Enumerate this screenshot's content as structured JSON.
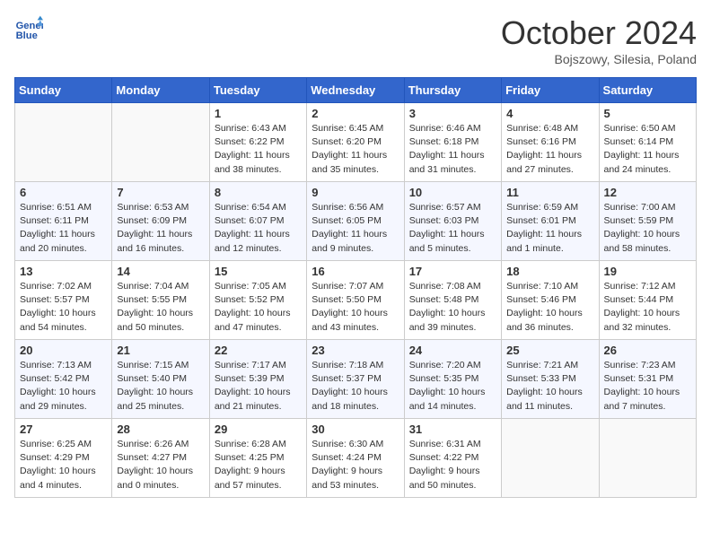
{
  "header": {
    "logo_line1": "General",
    "logo_line2": "Blue",
    "month": "October 2024",
    "location": "Bojszowy, Silesia, Poland"
  },
  "weekdays": [
    "Sunday",
    "Monday",
    "Tuesday",
    "Wednesday",
    "Thursday",
    "Friday",
    "Saturday"
  ],
  "weeks": [
    [
      {
        "day": "",
        "content": ""
      },
      {
        "day": "",
        "content": ""
      },
      {
        "day": "1",
        "content": "Sunrise: 6:43 AM\nSunset: 6:22 PM\nDaylight: 11 hours and 38 minutes."
      },
      {
        "day": "2",
        "content": "Sunrise: 6:45 AM\nSunset: 6:20 PM\nDaylight: 11 hours and 35 minutes."
      },
      {
        "day": "3",
        "content": "Sunrise: 6:46 AM\nSunset: 6:18 PM\nDaylight: 11 hours and 31 minutes."
      },
      {
        "day": "4",
        "content": "Sunrise: 6:48 AM\nSunset: 6:16 PM\nDaylight: 11 hours and 27 minutes."
      },
      {
        "day": "5",
        "content": "Sunrise: 6:50 AM\nSunset: 6:14 PM\nDaylight: 11 hours and 24 minutes."
      }
    ],
    [
      {
        "day": "6",
        "content": "Sunrise: 6:51 AM\nSunset: 6:11 PM\nDaylight: 11 hours and 20 minutes."
      },
      {
        "day": "7",
        "content": "Sunrise: 6:53 AM\nSunset: 6:09 PM\nDaylight: 11 hours and 16 minutes."
      },
      {
        "day": "8",
        "content": "Sunrise: 6:54 AM\nSunset: 6:07 PM\nDaylight: 11 hours and 12 minutes."
      },
      {
        "day": "9",
        "content": "Sunrise: 6:56 AM\nSunset: 6:05 PM\nDaylight: 11 hours and 9 minutes."
      },
      {
        "day": "10",
        "content": "Sunrise: 6:57 AM\nSunset: 6:03 PM\nDaylight: 11 hours and 5 minutes."
      },
      {
        "day": "11",
        "content": "Sunrise: 6:59 AM\nSunset: 6:01 PM\nDaylight: 11 hours and 1 minute."
      },
      {
        "day": "12",
        "content": "Sunrise: 7:00 AM\nSunset: 5:59 PM\nDaylight: 10 hours and 58 minutes."
      }
    ],
    [
      {
        "day": "13",
        "content": "Sunrise: 7:02 AM\nSunset: 5:57 PM\nDaylight: 10 hours and 54 minutes."
      },
      {
        "day": "14",
        "content": "Sunrise: 7:04 AM\nSunset: 5:55 PM\nDaylight: 10 hours and 50 minutes."
      },
      {
        "day": "15",
        "content": "Sunrise: 7:05 AM\nSunset: 5:52 PM\nDaylight: 10 hours and 47 minutes."
      },
      {
        "day": "16",
        "content": "Sunrise: 7:07 AM\nSunset: 5:50 PM\nDaylight: 10 hours and 43 minutes."
      },
      {
        "day": "17",
        "content": "Sunrise: 7:08 AM\nSunset: 5:48 PM\nDaylight: 10 hours and 39 minutes."
      },
      {
        "day": "18",
        "content": "Sunrise: 7:10 AM\nSunset: 5:46 PM\nDaylight: 10 hours and 36 minutes."
      },
      {
        "day": "19",
        "content": "Sunrise: 7:12 AM\nSunset: 5:44 PM\nDaylight: 10 hours and 32 minutes."
      }
    ],
    [
      {
        "day": "20",
        "content": "Sunrise: 7:13 AM\nSunset: 5:42 PM\nDaylight: 10 hours and 29 minutes."
      },
      {
        "day": "21",
        "content": "Sunrise: 7:15 AM\nSunset: 5:40 PM\nDaylight: 10 hours and 25 minutes."
      },
      {
        "day": "22",
        "content": "Sunrise: 7:17 AM\nSunset: 5:39 PM\nDaylight: 10 hours and 21 minutes."
      },
      {
        "day": "23",
        "content": "Sunrise: 7:18 AM\nSunset: 5:37 PM\nDaylight: 10 hours and 18 minutes."
      },
      {
        "day": "24",
        "content": "Sunrise: 7:20 AM\nSunset: 5:35 PM\nDaylight: 10 hours and 14 minutes."
      },
      {
        "day": "25",
        "content": "Sunrise: 7:21 AM\nSunset: 5:33 PM\nDaylight: 10 hours and 11 minutes."
      },
      {
        "day": "26",
        "content": "Sunrise: 7:23 AM\nSunset: 5:31 PM\nDaylight: 10 hours and 7 minutes."
      }
    ],
    [
      {
        "day": "27",
        "content": "Sunrise: 6:25 AM\nSunset: 4:29 PM\nDaylight: 10 hours and 4 minutes."
      },
      {
        "day": "28",
        "content": "Sunrise: 6:26 AM\nSunset: 4:27 PM\nDaylight: 10 hours and 0 minutes."
      },
      {
        "day": "29",
        "content": "Sunrise: 6:28 AM\nSunset: 4:25 PM\nDaylight: 9 hours and 57 minutes."
      },
      {
        "day": "30",
        "content": "Sunrise: 6:30 AM\nSunset: 4:24 PM\nDaylight: 9 hours and 53 minutes."
      },
      {
        "day": "31",
        "content": "Sunrise: 6:31 AM\nSunset: 4:22 PM\nDaylight: 9 hours and 50 minutes."
      },
      {
        "day": "",
        "content": ""
      },
      {
        "day": "",
        "content": ""
      }
    ]
  ]
}
